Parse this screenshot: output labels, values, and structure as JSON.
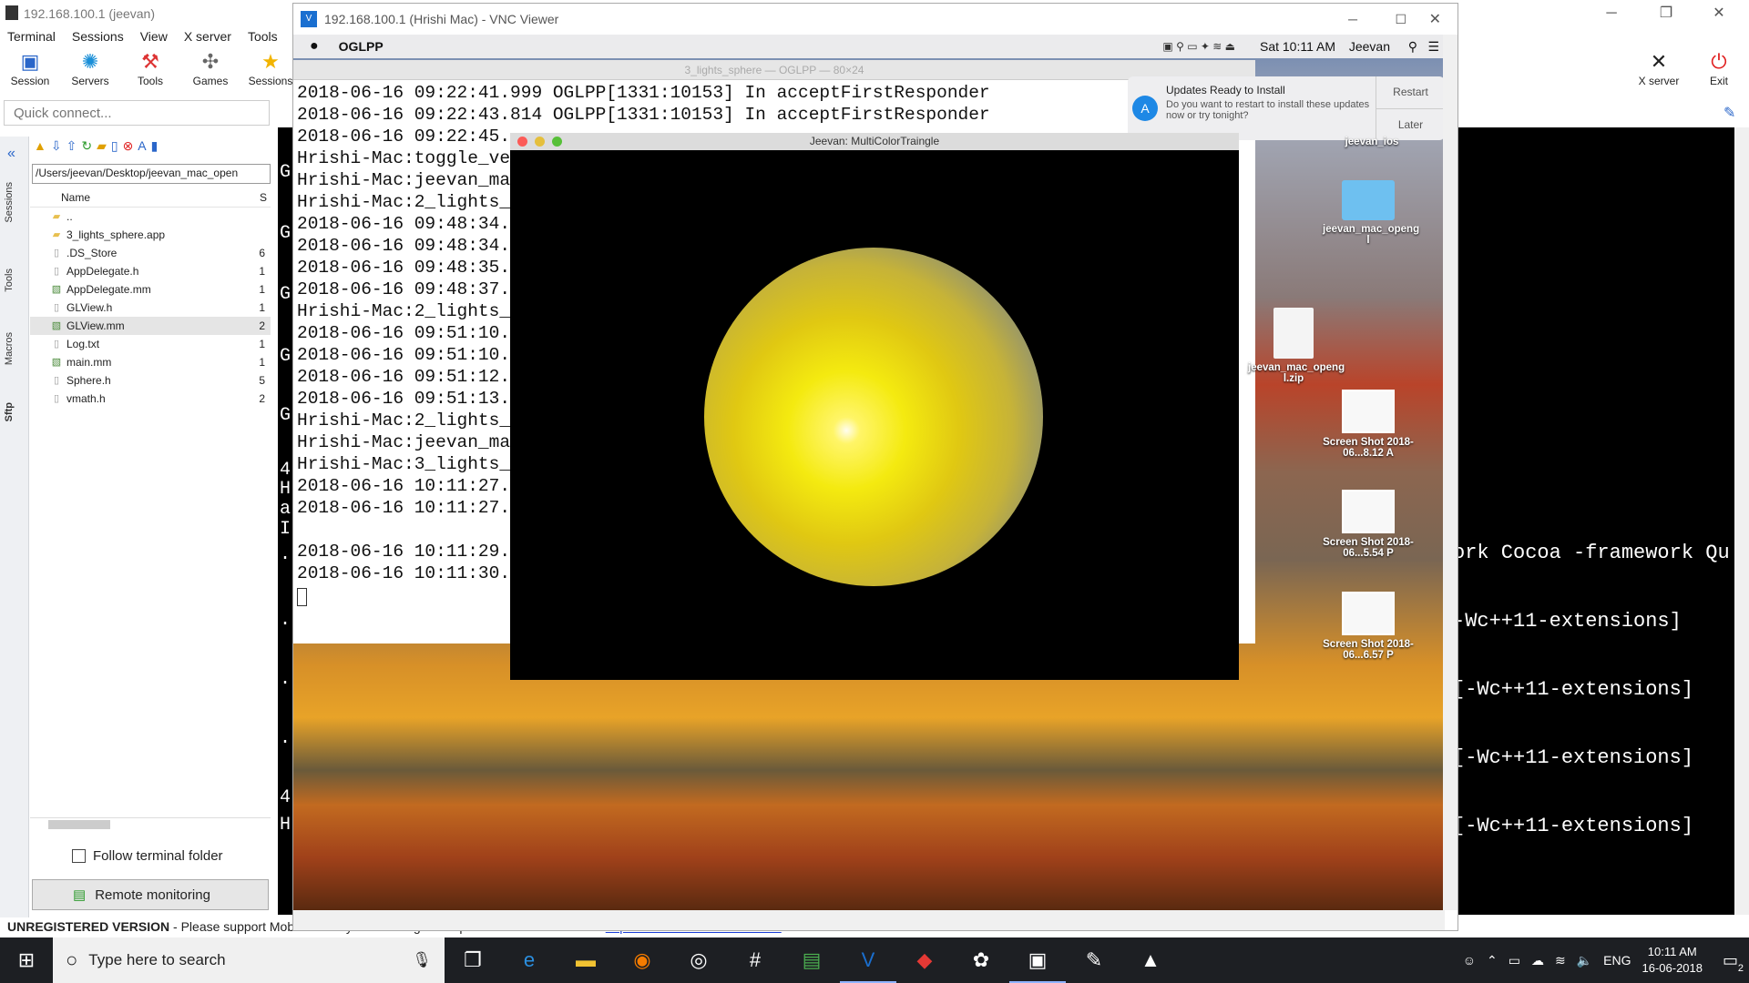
{
  "mobaxterm": {
    "title": "192.168.100.1 (jeevan)",
    "menu": [
      "Terminal",
      "Sessions",
      "View",
      "X server",
      "Tools"
    ],
    "toolbar": [
      {
        "label": "Session",
        "icon": "session-icon"
      },
      {
        "label": "Servers",
        "icon": "servers-icon"
      },
      {
        "label": "Tools",
        "icon": "tools-icon"
      },
      {
        "label": "Games",
        "icon": "games-icon"
      },
      {
        "label": "Sessions",
        "icon": "sessions-icon"
      }
    ],
    "toolbar_right": [
      {
        "label": "X server",
        "icon": "x-server-icon"
      },
      {
        "label": "Exit",
        "icon": "power-icon"
      }
    ],
    "quick_connect_placeholder": "Quick connect...",
    "side_tabs": [
      "Sessions",
      "Tools",
      "Macros",
      "Sftp"
    ],
    "sftp": {
      "path": "/Users/jeevan/Desktop/jeevan_mac_open",
      "col_name": "Name",
      "col_size": "S",
      "files": [
        {
          "name": "..",
          "size": "",
          "type": "folder"
        },
        {
          "name": "3_lights_sphere.app",
          "size": "",
          "type": "folder"
        },
        {
          "name": ".DS_Store",
          "size": "6",
          "type": "file"
        },
        {
          "name": "AppDelegate.h",
          "size": "1",
          "type": "file"
        },
        {
          "name": "AppDelegate.mm",
          "size": "1",
          "type": "code"
        },
        {
          "name": "GLView.h",
          "size": "1",
          "type": "file"
        },
        {
          "name": "GLView.mm",
          "size": "2",
          "type": "code",
          "selected": true
        },
        {
          "name": "Log.txt",
          "size": "1",
          "type": "file"
        },
        {
          "name": "main.mm",
          "size": "1",
          "type": "code"
        },
        {
          "name": "Sphere.h",
          "size": "5",
          "type": "file"
        },
        {
          "name": "vmath.h",
          "size": "2",
          "type": "file"
        }
      ],
      "follow_label": "Follow terminal folder",
      "remote_label": "Remote monitoring"
    },
    "terminal_right": [
      "ork Cocoa -framework Qu",
      "-Wc++11-extensions]",
      "[-Wc++11-extensions]",
      "[-Wc++11-extensions]",
      "[-Wc++11-extensions]"
    ],
    "terminal_left_chars": [
      "G",
      "G",
      "G",
      "G",
      "G",
      "4",
      "H",
      "a",
      "I",
      ".",
      ".",
      ".",
      ".",
      "4",
      "H"
    ],
    "status_unreg": "UNREGISTERED VERSION",
    "status_rest": "  -  Please support MobaXterm by subscribing to the professional edition here:  ",
    "status_link": "https://mobaxterm.mobatek.net"
  },
  "vnc": {
    "title": "192.168.100.1 (Hrishi Mac) - VNC Viewer",
    "mac_menu": {
      "app": "OGLPP",
      "time": "Sat 10:11 AM",
      "user": "Jeevan"
    },
    "terminal_title": "3_lights_sphere — OGLPP — 80×24",
    "terminal_lines": [
      "2018-06-16 09:22:41.999 OGLPP[1331:10153] In acceptFirstResponder",
      "2018-06-16 09:22:43.814 OGLPP[1331:10153] In acceptFirstResponder",
      "2018-06-16 09:22:45.",
      "Hrishi-Mac:toggle_ve",
      "Hrishi-Mac:jeevan_ma",
      "Hrishi-Mac:2_lights_",
      "2018-06-16 09:48:34.",
      "2018-06-16 09:48:34.",
      "2018-06-16 09:48:35.",
      "2018-06-16 09:48:37.",
      "Hrishi-Mac:2_lights_",
      "2018-06-16 09:51:10.",
      "2018-06-16 09:51:10.",
      "2018-06-16 09:51:12.",
      "2018-06-16 09:51:13.",
      "Hrishi-Mac:2_lights_",
      "Hrishi-Mac:jeevan_ma",
      "Hrishi-Mac:3_lights_",
      "2018-06-16 10:11:27.",
      "2018-06-16 10:11:27.",
      "",
      "2018-06-16 10:11:29.",
      "2018-06-16 10:11:30."
    ],
    "gl_title": "Jeevan: MultiColorTraingle",
    "notification": {
      "title": "Updates Ready to Install",
      "body": "Do you want to restart to install these updates now or try tonight?",
      "restart": "Restart",
      "later": "Later"
    },
    "desktop_icons": [
      {
        "label": "jeevan_ios",
        "icon": "folder-icon"
      },
      {
        "label": "jeevan_mac_openg l",
        "icon": "folder-icon"
      },
      {
        "label": "jeevan_mac_openg l.zip",
        "icon": "zip-icon"
      },
      {
        "label": "Screen Shot 2018-06...8.12 A",
        "icon": "screenshot-icon"
      },
      {
        "label": "Screen Shot 2018-06...5.54 P",
        "icon": "screenshot-icon"
      },
      {
        "label": "Screen Shot 2018-06...6.57 P",
        "icon": "screenshot-icon"
      }
    ]
  },
  "taskbar": {
    "search_placeholder": "Type here to search",
    "lang": "ENG",
    "time": "10:11 AM",
    "date": "16-06-2018",
    "notif_count": "2"
  }
}
